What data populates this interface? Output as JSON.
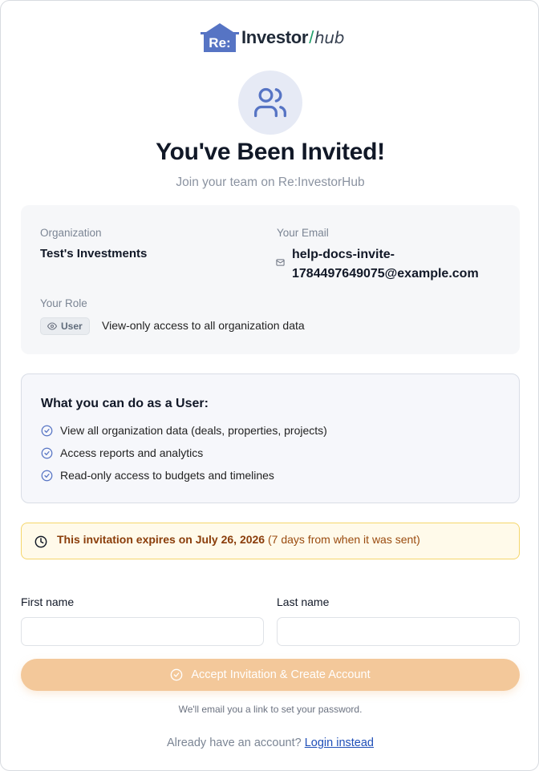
{
  "brand": {
    "logo_mark": "Re:",
    "name_main": "Investor",
    "name_slash": "/",
    "name_sub": "hub",
    "accent_blue": "#5674c4",
    "accent_green": "#22a06b"
  },
  "header": {
    "icon": "users-icon",
    "title": "You've Been Invited!",
    "subtitle": "Join your team on Re:InvestorHub"
  },
  "invite": {
    "org_label": "Organization",
    "org_value": "Test's Investments",
    "email_label": "Your Email",
    "email_value": "help-docs-invite-1784497649075@example.com",
    "role_label": "Your Role",
    "role_badge": "User",
    "role_description": "View-only access to all organization data"
  },
  "permissions": {
    "title": "What you can do as a User:",
    "items": [
      "View all organization data (deals, properties, projects)",
      "Access reports and analytics",
      "Read-only access to budgets and timelines"
    ]
  },
  "expiry": {
    "bold_text": "This invitation expires on July 26, 2026",
    "detail_text": "(7 days from when it was sent)",
    "color": "#9a4b0f"
  },
  "form": {
    "first_name_label": "First name",
    "first_name_value": "",
    "last_name_label": "Last name",
    "last_name_value": ""
  },
  "actions": {
    "accept_label": "Accept Invitation & Create Account",
    "accept_color": "#f3c89a",
    "note": "We'll email you a link to set your password.",
    "login_prompt": "Already have an account?",
    "login_link": "Login instead"
  }
}
